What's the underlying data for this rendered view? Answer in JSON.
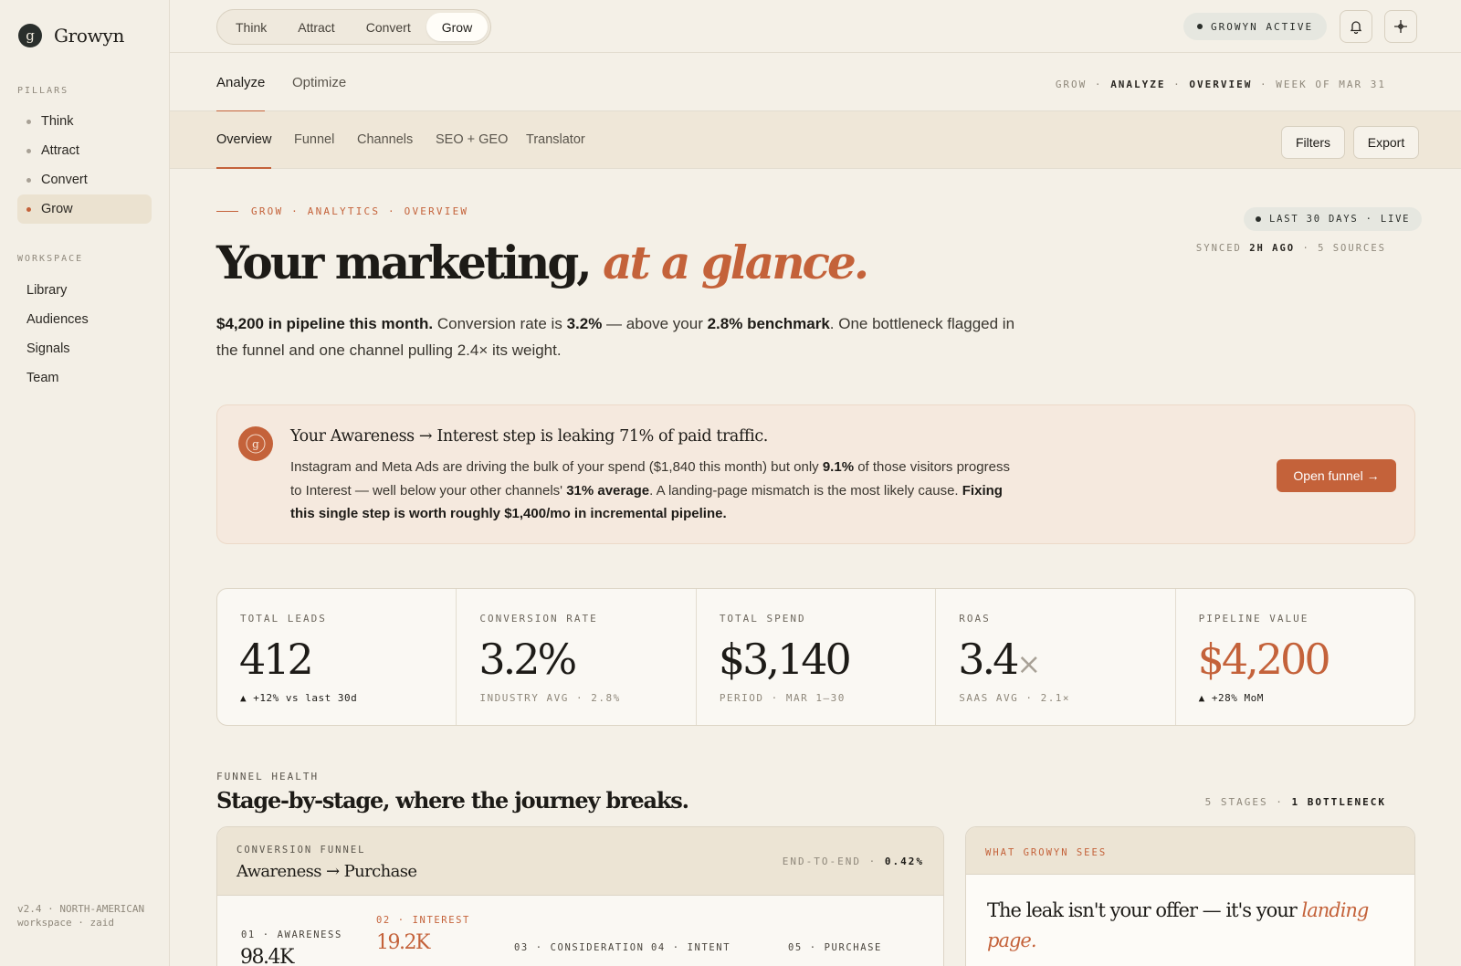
{
  "brand": {
    "logo_letter": "g",
    "name": "Growyn"
  },
  "sidebar": {
    "pillars_label": "PILLARS",
    "pillars": [
      {
        "label": "Think"
      },
      {
        "label": "Attract"
      },
      {
        "label": "Convert"
      },
      {
        "label": "Grow",
        "active": true
      }
    ],
    "workspace_label": "WORKSPACE",
    "workspace": [
      {
        "label": "Library"
      },
      {
        "label": "Audiences"
      },
      {
        "label": "Signals"
      },
      {
        "label": "Team"
      }
    ],
    "footer": "v2.4 · NORTH-AMERICAN workspace · zaid"
  },
  "topbar": {
    "pillar_tabs": [
      {
        "label": "Think"
      },
      {
        "label": "Attract"
      },
      {
        "label": "Convert"
      },
      {
        "label": "Grow",
        "active": true
      }
    ],
    "status": "GROWYN ACTIVE",
    "icons": [
      "bell-icon",
      "sparkle-icon"
    ]
  },
  "subnav": {
    "tabs": [
      {
        "label": "Analyze",
        "active": true
      },
      {
        "label": "Optimize"
      }
    ],
    "breadcrumb": {
      "a": "GROW",
      "b": "ANALYZE",
      "c": "OVERVIEW",
      "d": "WEEK OF MAR 31"
    }
  },
  "section_tabs": {
    "tabs": [
      {
        "label": "Overview",
        "active": true
      },
      {
        "label": "Funnel"
      },
      {
        "label": "Channels"
      },
      {
        "label": "SEO + GEO"
      },
      {
        "label": "Translator"
      }
    ],
    "filters_label": "Filters",
    "export_label": "Export"
  },
  "hero": {
    "eyebrow": "GROW · ANALYTICS · OVERVIEW",
    "live_chip": "LAST 30 DAYS · LIVE",
    "synced_a": "SYNCED",
    "synced_b": "2H AGO",
    "synced_c": "· 5 SOURCES",
    "headline_a": "Your marketing,",
    "headline_b": "at a glance.",
    "lede": {
      "b1": "$4,200 in pipeline this month.",
      "t1": " Conversion rate is ",
      "b2": "3.2%",
      "t2": " — above your ",
      "b3": "2.8% benchmark",
      "t3": ". One bottleneck flagged in the funnel and one channel pulling 2.4× its weight."
    }
  },
  "alert": {
    "icon_letter": "g",
    "title": "Your Awareness → Interest step is leaking 71% of paid traffic.",
    "t1": "Instagram and Meta Ads are driving the bulk of your spend ($1,840 this month) but only ",
    "b1": "9.1%",
    "t2": " of those visitors progress to Interest — well below your other channels' ",
    "b2": "31% average",
    "t3": ". A landing-page mismatch is the most likely cause. ",
    "b3": "Fixing this single step is worth roughly $1,400/mo in incremental pipeline.",
    "button": "Open funnel →"
  },
  "kpis": [
    {
      "label": "TOTAL LEADS",
      "value": "412",
      "foot": "▲ +12% vs last 30d"
    },
    {
      "label": "CONVERSION RATE",
      "value": "3.2%",
      "foot": "INDUSTRY AVG · 2.8%"
    },
    {
      "label": "TOTAL SPEND",
      "value": "$3,140",
      "foot": "PERIOD · MAR 1–30"
    },
    {
      "label": "ROAS",
      "value": "3.4",
      "suffix": "×",
      "foot": "SAAS AVG · 2.1×"
    },
    {
      "label": "PIPELINE VALUE",
      "value": "$4,200",
      "foot": "▲ +28% MoM"
    }
  ],
  "funnel_health": {
    "label": "FUNNEL HEALTH",
    "title": "Stage-by-stage, where the journey breaks.",
    "meta_a": "5 STAGES ·",
    "meta_b": "1 BOTTLENECK",
    "card": {
      "label": "CONVERSION FUNNEL",
      "title": "Awareness → Purchase",
      "e2e_label": "END-TO-END ·",
      "e2e_value": "0.42%",
      "stages": [
        {
          "label": "01 · AWARENESS",
          "value": "98.4K"
        },
        {
          "label": "02 · INTEREST",
          "value": "19.2K",
          "bottleneck": true
        },
        {
          "label": "03 · CONSIDERATION"
        },
        {
          "label": "04 · INTENT"
        },
        {
          "label": "05 · PURCHASE"
        }
      ]
    }
  },
  "insight": {
    "label": "WHAT GROWYN SEES",
    "text_a": "The leak isn't your offer — it's your ",
    "text_b": "landing page."
  },
  "colors": {
    "accent": "#c4623a",
    "background": "#f4f0e7",
    "ink": "#1d1b17"
  }
}
